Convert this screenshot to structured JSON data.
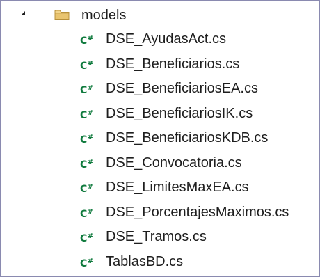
{
  "tree": {
    "folder": {
      "name": "models",
      "expanded": true,
      "icon": "folder-icon"
    },
    "file_icon_text": "C#",
    "file_icon_color": "#0f7a3d",
    "files": [
      {
        "name": "DSE_AyudasAct.cs"
      },
      {
        "name": "DSE_Beneficiarios.cs"
      },
      {
        "name": "DSE_BeneficiariosEA.cs"
      },
      {
        "name": "DSE_BeneficiariosIK.cs"
      },
      {
        "name": "DSE_BeneficiariosKDB.cs"
      },
      {
        "name": "DSE_Convocatoria.cs"
      },
      {
        "name": "DSE_LimitesMaxEA.cs"
      },
      {
        "name": "DSE_PorcentajesMaximos.cs"
      },
      {
        "name": "DSE_Tramos.cs"
      },
      {
        "name": "TablasBD.cs"
      }
    ]
  }
}
